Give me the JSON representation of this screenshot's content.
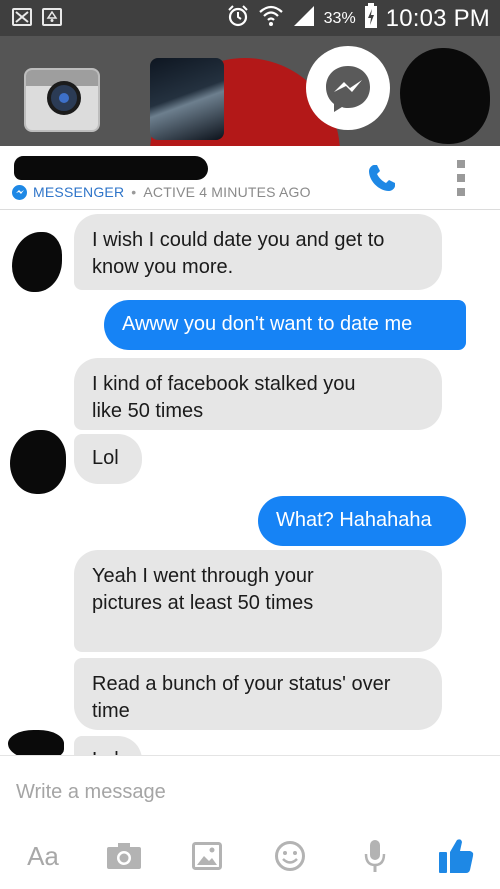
{
  "status_bar": {
    "battery_percent": "33%",
    "time": "10:03 PM",
    "icons": [
      "mail-icon",
      "recycle-icon",
      "alarm-icon",
      "wifi-icon",
      "signal-icon",
      "battery-charging-icon"
    ]
  },
  "chat_heads": {
    "items": [
      "camera-app-head",
      "photo-thumbnail-head",
      "messenger-head",
      "redacted-contact-head"
    ]
  },
  "header": {
    "brand": "MESSENGER",
    "separator": "•",
    "activity": "ACTIVE 4 MINUTES AGO",
    "icons": [
      "phone-call-icon",
      "more-vertical-icon"
    ]
  },
  "messages": [
    {
      "direction": "incoming",
      "text": "I wish I could date you and get to know you more."
    },
    {
      "direction": "outgoing",
      "text": "Awww you don't want to date me"
    },
    {
      "direction": "incoming",
      "text": "I kind of facebook stalked you like 50 times"
    },
    {
      "direction": "incoming",
      "text": "Lol"
    },
    {
      "direction": "outgoing",
      "text": "What? Hahahaha"
    },
    {
      "direction": "incoming",
      "text": "Yeah I went through your pictures at least 50 times"
    },
    {
      "direction": "incoming",
      "text": "Read a bunch of your status' over time"
    },
    {
      "direction": "incoming",
      "text": "Lol"
    }
  ],
  "composer": {
    "placeholder": "Write a message"
  },
  "toolbar": {
    "text_format_label": "Aa",
    "icons": [
      "camera-icon",
      "gallery-icon",
      "emoji-icon",
      "microphone-icon",
      "thumbs-up-icon"
    ]
  },
  "colors": {
    "outgoing_bubble": "#1683f5",
    "incoming_bubble": "#e6e6e6",
    "accent": "#1e88e5",
    "status_bar": "#3f3f3f"
  }
}
